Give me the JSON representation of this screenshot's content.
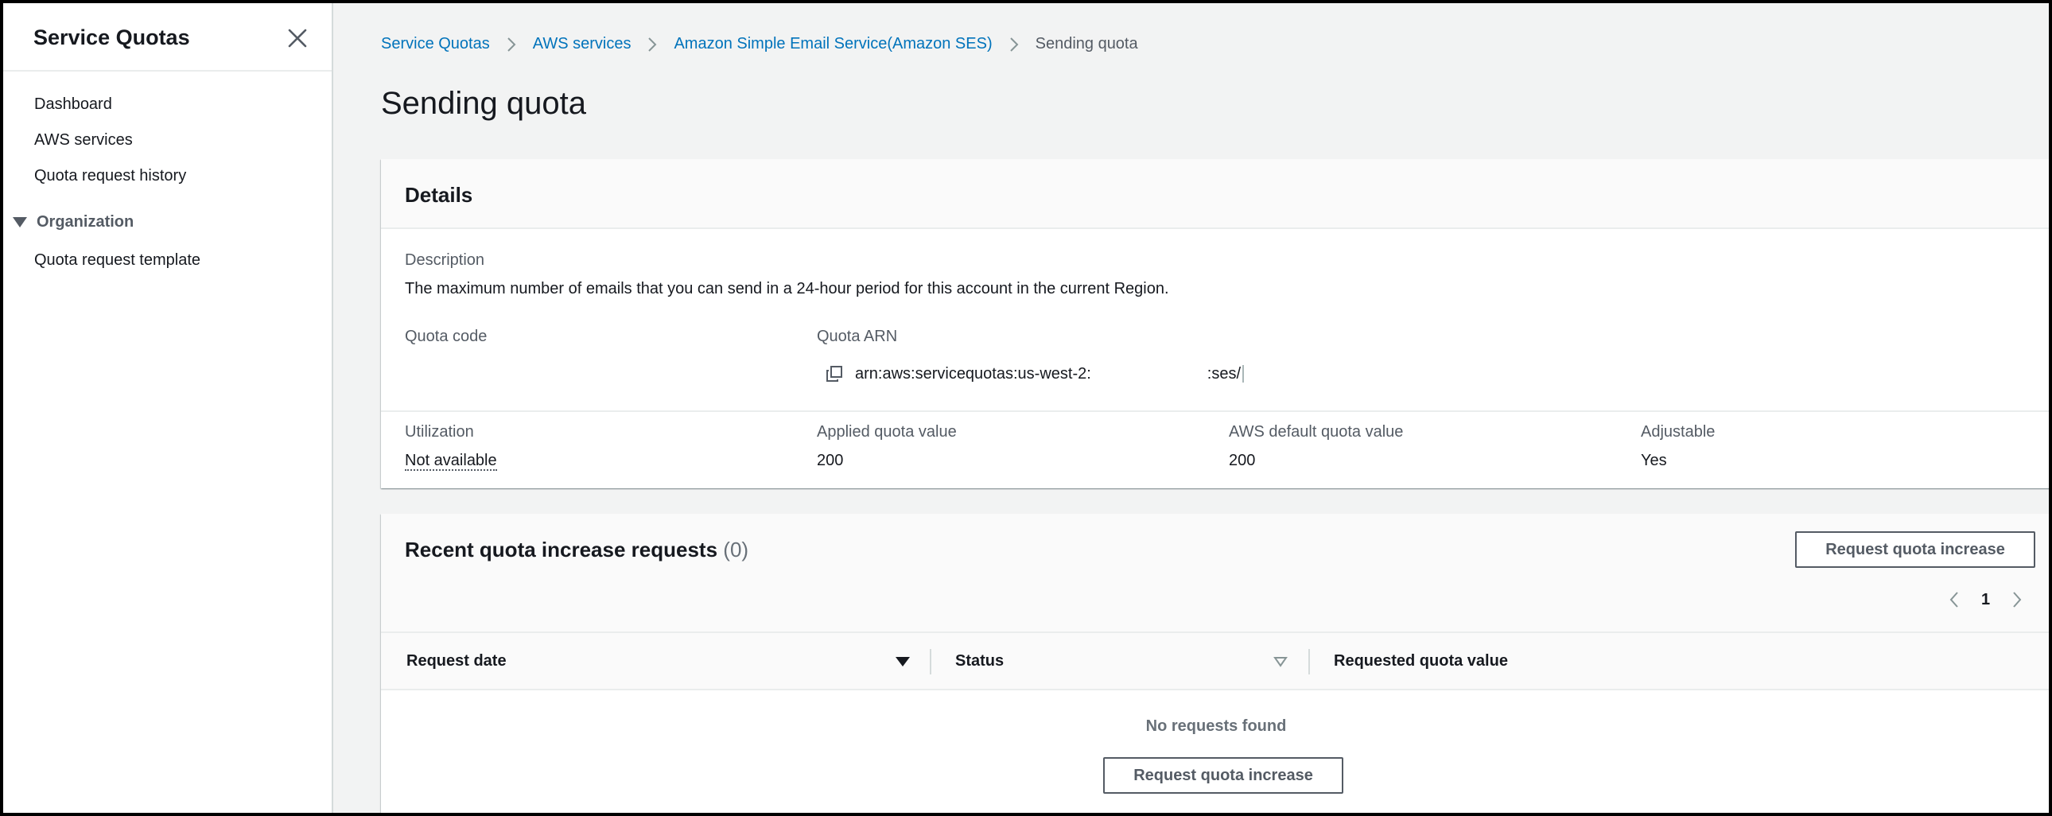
{
  "sidebar": {
    "title": "Service Quotas",
    "items": [
      "Dashboard",
      "AWS services",
      "Quota request history"
    ],
    "section": "Organization",
    "section_items": [
      "Quota request template"
    ]
  },
  "breadcrumb": {
    "items": [
      "Service Quotas",
      "AWS services",
      "Amazon Simple Email Service(Amazon SES)"
    ],
    "current": "Sending quota"
  },
  "page_title": "Sending quota",
  "details": {
    "heading": "Details",
    "description_label": "Description",
    "description": "The maximum number of emails that you can send in a 24-hour period for this account in the current Region.",
    "quota_code_label": "Quota code",
    "quota_code": "",
    "quota_arn_label": "Quota ARN",
    "quota_arn_prefix": "arn:aws:servicequotas:us-west-2:",
    "quota_arn_suffix": ":ses/",
    "utilization_label": "Utilization",
    "utilization": "Not available",
    "applied_label": "Applied quota value",
    "applied": "200",
    "default_label": "AWS default quota value",
    "default": "200",
    "adjustable_label": "Adjustable",
    "adjustable": "Yes"
  },
  "requests": {
    "heading": "Recent quota increase requests",
    "count": "(0)",
    "request_button": "Request quota increase",
    "page": "1",
    "columns": [
      "Request date",
      "Status",
      "Requested quota value"
    ],
    "empty": "No requests found",
    "empty_button": "Request quota increase"
  },
  "colors": {
    "link": "#0073bb",
    "text": "#16191f",
    "secondary": "#545b64",
    "background": "#f2f3f3"
  }
}
